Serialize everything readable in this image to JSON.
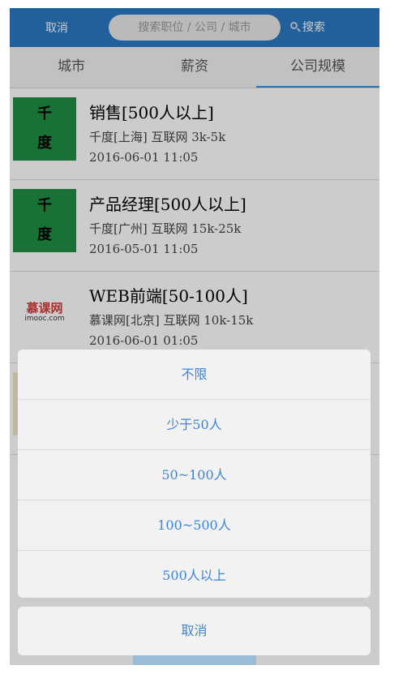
{
  "header": {
    "cancel_label": "取消",
    "search_placeholder": "搜索职位 / 公司 / 城市",
    "search_label": "搜索"
  },
  "tabs": [
    {
      "label": "城市",
      "active": false
    },
    {
      "label": "薪资",
      "active": false
    },
    {
      "label": "公司规模",
      "active": true
    }
  ],
  "jobs": [
    {
      "logo_text": [
        "千",
        "度"
      ],
      "logo_color": "#1e8f44",
      "title": "销售[500人以上]",
      "meta": "千度[上海] 互联网 3k-5k",
      "date": "2016-06-01 11:05"
    },
    {
      "logo_text": [
        "千",
        "度"
      ],
      "logo_color": "#1e8f44",
      "title": "产品经理[500人以上]",
      "meta": "千度[广州] 互联网 15k-25k",
      "date": "2016-05-01 11:05"
    },
    {
      "logo_brand": "慕课网",
      "logo_brand_en": "imooc.com",
      "title": "WEB前端[50-100人]",
      "meta": "慕课网[北京] 互联网 10k-15k",
      "date": "2016-06-01 01:05"
    }
  ],
  "action_sheet": {
    "options": [
      "不限",
      "少于50人",
      "50~100人",
      "100~500人",
      "500人以上"
    ],
    "cancel_label": "取消"
  },
  "colors": {
    "accent": "#2b78c2",
    "option_text": "#3d86d6"
  }
}
